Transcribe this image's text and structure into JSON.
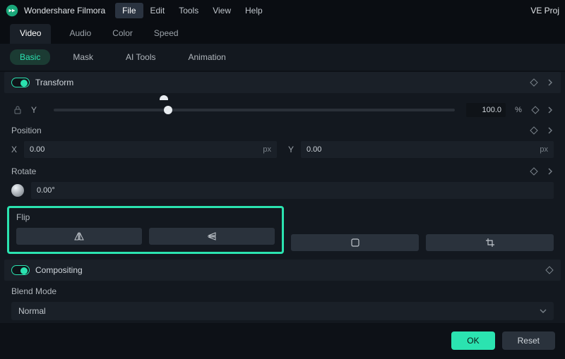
{
  "app": {
    "name": "Wondershare Filmora",
    "project": "VE Proj"
  },
  "menubar": {
    "items": [
      "File",
      "Edit",
      "Tools",
      "View",
      "Help"
    ],
    "active": 0
  },
  "primary_tabs": {
    "items": [
      "Video",
      "Audio",
      "Color",
      "Speed"
    ],
    "active": 0
  },
  "secondary_tabs": {
    "items": [
      "Basic",
      "Mask",
      "AI Tools",
      "Animation"
    ],
    "active": 0
  },
  "transform": {
    "label": "Transform",
    "y_label": "Y",
    "y_value": "100.0",
    "y_unit": "%"
  },
  "position": {
    "label": "Position",
    "x_label": "X",
    "x_value": "0.00",
    "x_unit": "px",
    "y_label": "Y",
    "y_value": "0.00",
    "y_unit": "px"
  },
  "rotate": {
    "label": "Rotate",
    "value": "0.00°"
  },
  "flip": {
    "label": "Flip"
  },
  "compositing": {
    "label": "Compositing"
  },
  "blend": {
    "label": "Blend Mode",
    "value": "Normal"
  },
  "footer": {
    "ok": "OK",
    "reset": "Reset"
  },
  "icons": {
    "keyframe": "keyframe-icon",
    "chevron": "chevron-right-icon",
    "lock": "lock-icon",
    "mirror_h": "mirror-horizontal-icon",
    "mirror_v": "mirror-vertical-icon",
    "square": "square-icon",
    "crop": "crop-icon",
    "chevdown": "chevron-down-icon"
  }
}
